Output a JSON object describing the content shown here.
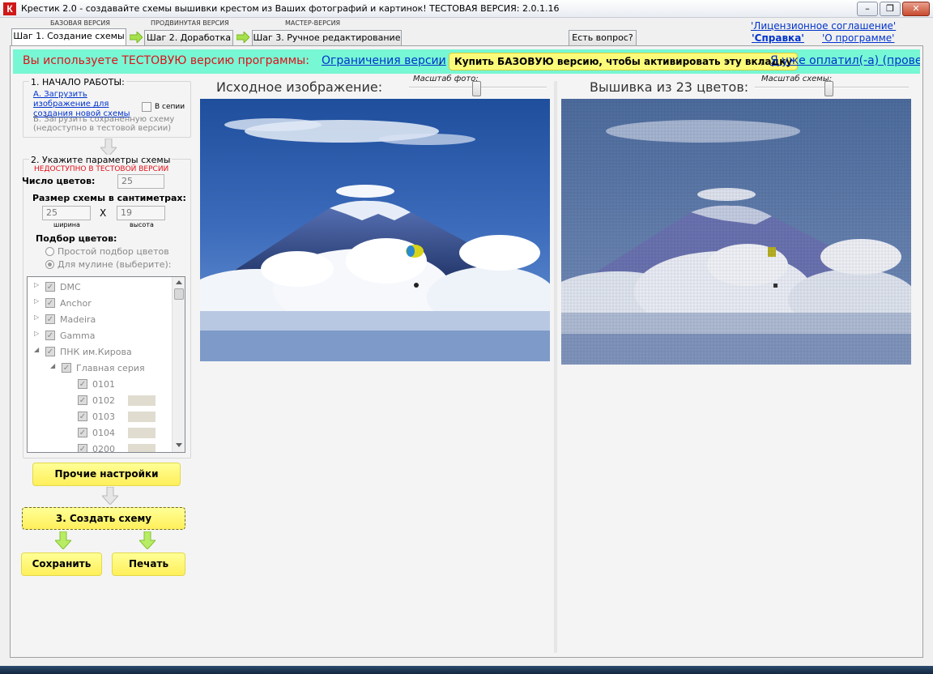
{
  "window": {
    "title": "Крестик 2.0 - создавайте схемы вышивки крестом из Ваших фотографий и картинок! ТЕСТОВАЯ ВЕРСИЯ: 2.0.1.16",
    "app_icon": "К",
    "minimize": "–",
    "maximize": "❐",
    "close": "✕"
  },
  "tabs": [
    {
      "caption": "БАЗОВАЯ ВЕРСИЯ",
      "label": "Шаг 1. Создание схемы",
      "active": true
    },
    {
      "caption": "ПРОДВИНУТАЯ ВЕРСИЯ",
      "label": "Шаг 2. Доработка",
      "active": false
    },
    {
      "caption": "МАСТЕР-ВЕРСИЯ",
      "label": "Шаг 3. Ручное редактирование",
      "active": false
    }
  ],
  "question_button": "Есть вопрос?",
  "top_links": {
    "license": "'Лицензионное соглашение'",
    "help": "'Справка'",
    "about": "'О программе'"
  },
  "info_bar": {
    "text": "Вы используете ТЕСТОВУЮ версию программы:",
    "link_limits": "Ограничения версии",
    "comma": ",",
    "buy_button": "Купить БАЗОВУЮ версию, чтобы активировать эту вкладку",
    "link_paid": "Я уже оплатил(-а) (проверка"
  },
  "section1": {
    "title": "1. НАЧАЛО РАБОТЫ:",
    "load_image": "А. Загрузить изображение для создания новой схемы",
    "sepia": "В сепии",
    "load_scheme": "Б. Загрузить сохранённую схему (недоступно в тестовой версии)"
  },
  "section2": {
    "title": "2. Укажите параметры схемы",
    "unavailable": "НЕДОСТУПНО В ТЕСТОВОЙ ВЕРСИИ",
    "colors_label": "Число цветов:",
    "colors_value": "25",
    "size_label": "Размер схемы в сантиметрах:",
    "width_value": "25",
    "times": "X",
    "height_value": "19",
    "width_label": "ширина",
    "height_label": "высота",
    "palette_label": "Подбор цветов:",
    "opt_simple": "Простой подбор цветов",
    "opt_mouline": "Для мулине (выберите):"
  },
  "tree": [
    {
      "label": "DMC",
      "level": 0,
      "expander": "▷"
    },
    {
      "label": "Anchor",
      "level": 0,
      "expander": "▷"
    },
    {
      "label": "Madeira",
      "level": 0,
      "expander": "▷"
    },
    {
      "label": "Gamma",
      "level": 0,
      "expander": "▷"
    },
    {
      "label": "ПНК им.Кирова",
      "level": 0,
      "expander": "◢"
    },
    {
      "label": "Главная серия",
      "level": 1,
      "expander": "◢"
    },
    {
      "label": "0101",
      "level": 2,
      "expander": ""
    },
    {
      "label": "0102",
      "level": 2,
      "expander": ""
    },
    {
      "label": "0103",
      "level": 2,
      "expander": ""
    },
    {
      "label": "0104",
      "level": 2,
      "expander": ""
    },
    {
      "label": "0200",
      "level": 2,
      "expander": ""
    }
  ],
  "buttons": {
    "other_settings": "Прочие настройки",
    "create": "3. Создать схему",
    "save": "Сохранить",
    "print": "Печать"
  },
  "source": {
    "title": "Исходное изображение:",
    "scale_label": "Масштаб фото:"
  },
  "result": {
    "title": "Вышивка из 23 цветов:",
    "scale_label": "Масштаб схемы:"
  },
  "colors": {
    "info_bar": "#77f7d4",
    "warning": "#e0101a",
    "button_yellow": "#ffef5a",
    "link": "#0033cc"
  }
}
